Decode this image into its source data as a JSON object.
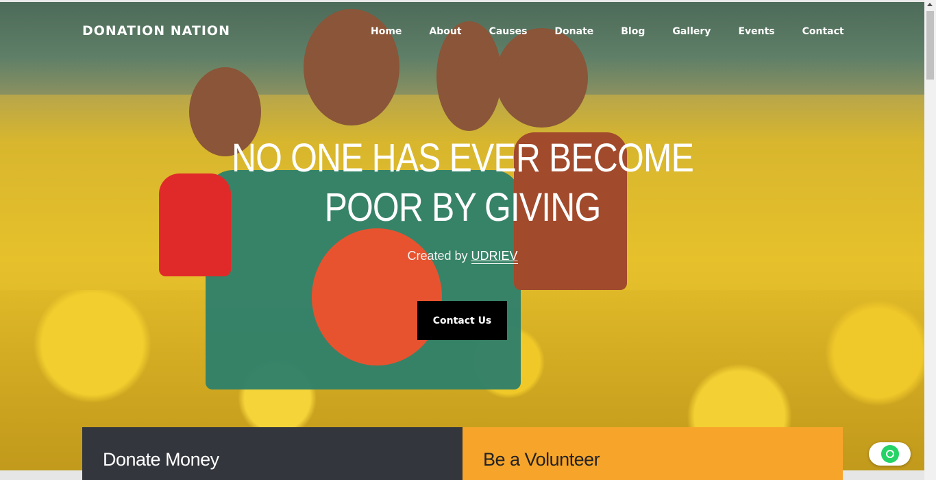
{
  "site": {
    "brand": "DONATION NATION"
  },
  "nav": {
    "items": [
      {
        "label": "Home"
      },
      {
        "label": "About"
      },
      {
        "label": "Causes"
      },
      {
        "label": "Donate"
      },
      {
        "label": "Blog"
      },
      {
        "label": "Gallery"
      },
      {
        "label": "Events"
      },
      {
        "label": "Contact"
      }
    ]
  },
  "hero": {
    "headline_line1": "NO ONE HAS EVER BECOME",
    "headline_line2": "POOR BY GIVING",
    "credit_prefix": "Created by",
    "credit_author": "UDRIEV",
    "cta_label": "Contact Us"
  },
  "panels": {
    "donate_title": "Donate Money",
    "volunteer_title": "Be a Volunteer"
  },
  "colors": {
    "dark_panel": "#33363c",
    "orange_panel": "#f7a52a",
    "cta_bg": "#000000",
    "whatsapp": "#25d366"
  },
  "icons": {
    "chat": "whatsapp-icon"
  }
}
